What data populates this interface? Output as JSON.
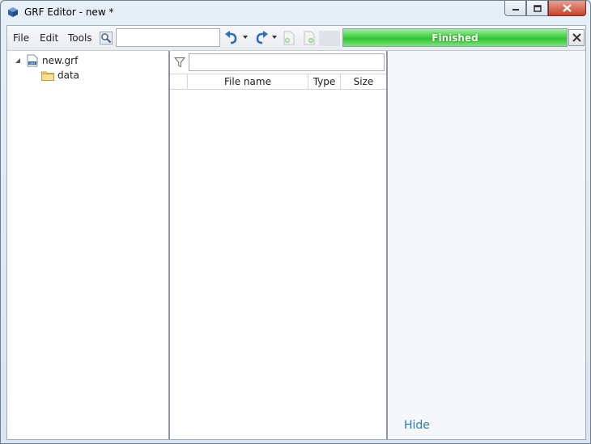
{
  "window": {
    "title": "GRF Editor - new *",
    "icons": {
      "app": "grf-editor-cube-icon",
      "minimize": "minimize-icon",
      "maximize": "maximize-icon",
      "close": "close-icon"
    }
  },
  "menu": {
    "file": "File",
    "edit": "Edit",
    "tools": "Tools"
  },
  "toolbar": {
    "search_value": "",
    "search_icon": "magnifier-icon",
    "undo_icon": "undo-icon",
    "redo_icon": "redo-icon",
    "add_icon": "add-file-icon",
    "extract_icon": "extract-file-icon"
  },
  "progress": {
    "label": "Finished",
    "fraction": 1.0,
    "color": "#46d246"
  },
  "tree": {
    "root": {
      "label": "new.grf",
      "icon": "grf-file-icon",
      "expanded": true
    },
    "children": [
      {
        "label": "data",
        "icon": "folder-icon"
      }
    ]
  },
  "file_list": {
    "filter_value": "",
    "filter_icon": "funnel-icon",
    "columns": [
      "File name",
      "Type",
      "Size"
    ],
    "rows": []
  },
  "preview": {
    "hide_label": "Hide"
  },
  "colors": {
    "accent_link": "#2a7ab8",
    "close_button": "#c7432b"
  }
}
